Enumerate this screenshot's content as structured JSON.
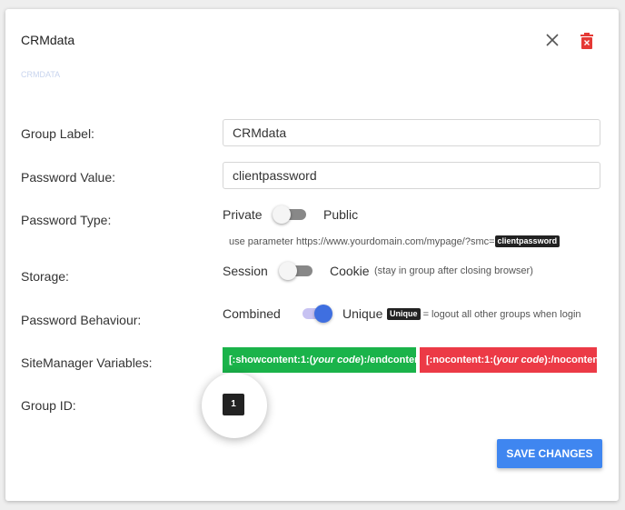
{
  "dialog": {
    "title": "CRMdata",
    "faint_text": "CRMDATA"
  },
  "group_label": {
    "label": "Group Label:",
    "value": "CRMdata"
  },
  "password_value": {
    "label": "Password Value:",
    "value": "clientpassword"
  },
  "password_type": {
    "label": "Password Type:",
    "option_left": "Private",
    "option_right": "Public",
    "state": "Private",
    "hint_prefix": "use parameter https://www.yourdomain.com/mypage/?smc=",
    "hint_tag": "clientpassword"
  },
  "storage": {
    "label": "Storage:",
    "option_left": "Session",
    "option_right": "Cookie",
    "state": "Session",
    "hint": "(stay in group after closing browser)"
  },
  "password_behaviour": {
    "label": "Password Behaviour:",
    "option_left": "Combined",
    "option_right": "Unique",
    "state": "Unique",
    "hint_tag": "Unique",
    "hint": "= logout all other groups when login"
  },
  "sitemanager_variables": {
    "label": "SiteManager Variables:",
    "show": {
      "prefix": "[:showcontent:1:(",
      "italic": "your code",
      "suffix": "):/endcontent:]"
    },
    "no": {
      "prefix": "[:nocontent:1:(",
      "italic": "your code",
      "suffix": "):/nocontent:]"
    }
  },
  "group_id": {
    "label": "Group ID:",
    "value": "1"
  },
  "save_label": "SAVE CHANGES",
  "colors": {
    "green": "#1ab34a",
    "red": "#ec3a46",
    "primary": "#3f86f0",
    "toggle_on": "#3f6fe0"
  }
}
